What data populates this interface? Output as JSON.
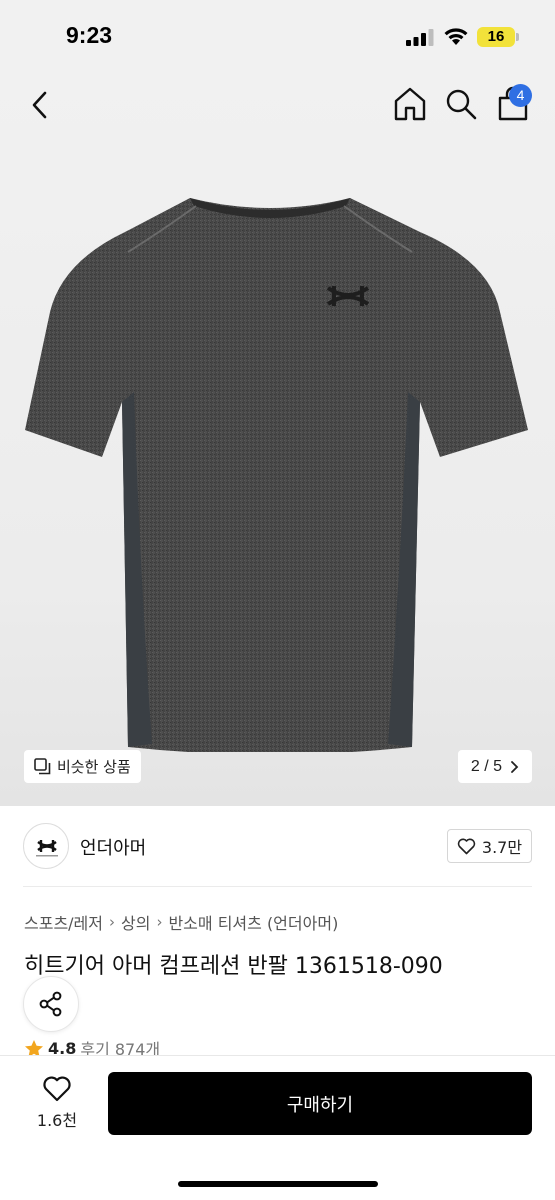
{
  "status_bar": {
    "time": "9:23",
    "battery": "16"
  },
  "top_nav": {
    "back_icon": "chevron-left-icon",
    "home_icon": "home-icon",
    "search_icon": "search-icon",
    "bag_icon": "shopping-bag-icon",
    "bag_badge": "4",
    "badge_color": "#2f6fe3"
  },
  "gallery": {
    "similar_label": "비슷한 상품",
    "counter": "2 / 5"
  },
  "brand": {
    "name": "언더아머",
    "likes": "3.7만"
  },
  "breadcrumb": [
    "스포츠/레저",
    "상의",
    "반소매 티셔츠 (언더아머)"
  ],
  "product": {
    "title": "히트기어 아머 컴프레션 반팔 1361518-090",
    "rating": "4.8",
    "reviews": "후기 874개"
  },
  "bottom_bar": {
    "wish_count": "1.6천",
    "buy_label": "구매하기"
  },
  "colors": {
    "accent": "#000000",
    "star": "#f2a61f",
    "shirt": "#4a4a4a"
  }
}
